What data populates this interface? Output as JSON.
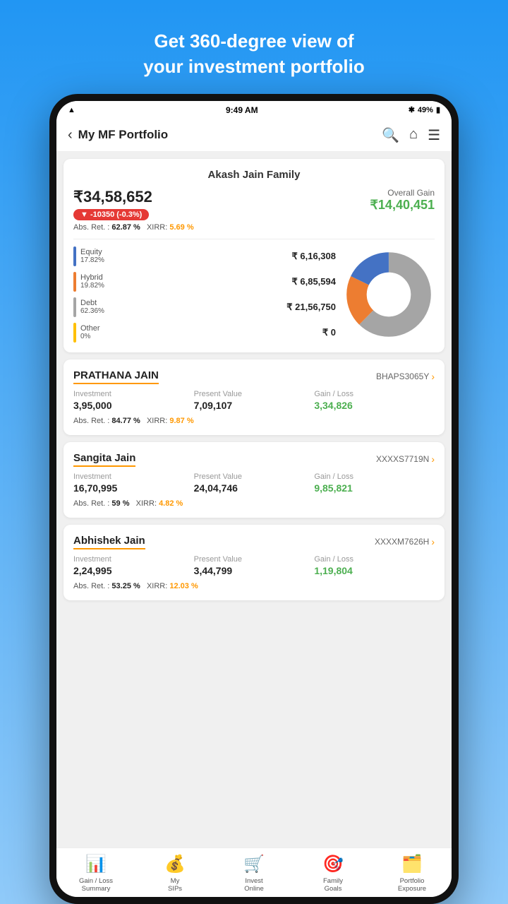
{
  "promo": {
    "line1": "Get 360-degree view of",
    "line2": "your investment portfolio"
  },
  "statusBar": {
    "time": "9:49 AM",
    "battery": "49%"
  },
  "header": {
    "back": "‹",
    "title": "My MF Portfolio",
    "searchIcon": "🔍",
    "homeIcon": "⌂",
    "menuIcon": "☰"
  },
  "portfolio": {
    "familyName": "Akash Jain Family",
    "totalValue": "₹34,58,652",
    "change": "▼ -10350  (-0.3%)",
    "overallGainLabel": "Overall Gain",
    "overallGainValue": "₹14,40,451",
    "absRet": "62.87 %",
    "xirr": "5.69 %",
    "segments": [
      {
        "name": "Equity",
        "pct": "17.82%",
        "amount": "₹ 6,16,308",
        "color": "#4472C4"
      },
      {
        "name": "Hybrid",
        "pct": "19.82%",
        "amount": "₹ 6,85,594",
        "color": "#ED7D31"
      },
      {
        "name": "Debt",
        "pct": "62.36%",
        "amount": "₹ 21,56,750",
        "color": "#A5A5A5"
      },
      {
        "name": "Other",
        "pct": "0%",
        "amount": "₹ 0",
        "color": "#FFC000"
      }
    ]
  },
  "members": [
    {
      "name": "PRATHANA JAIN",
      "id": "BHAPS3065Y",
      "investment": "3,95,000",
      "presentValue": "7,09,107",
      "gainLoss": "3,34,826",
      "absRet": "84.77 %",
      "xirr": "9.87 %"
    },
    {
      "name": "Sangita Jain",
      "id": "XXXXS7719N",
      "investment": "16,70,995",
      "presentValue": "24,04,746",
      "gainLoss": "9,85,821",
      "absRet": "59 %",
      "xirr": "4.82 %"
    },
    {
      "name": "Abhishek Jain",
      "id": "XXXXM7626H",
      "investment": "2,24,995",
      "presentValue": "3,44,799",
      "gainLoss": "1,19,804",
      "absRet": "53.25 %",
      "xirr": "12.03 %"
    }
  ],
  "bottomNav": [
    {
      "label": "Gain / Loss\nSummary",
      "icon": "📊"
    },
    {
      "label": "My\nSIPs",
      "icon": "💰"
    },
    {
      "label": "Invest\nOnline",
      "icon": "🛒"
    },
    {
      "label": "Family\nGoals",
      "icon": "🎯"
    },
    {
      "label": "Portfolio\nExposure",
      "icon": "🗂️"
    }
  ]
}
